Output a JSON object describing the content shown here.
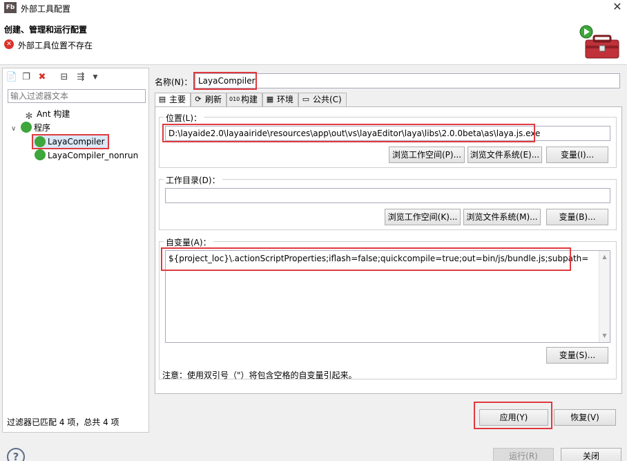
{
  "window": {
    "app_icon_text": "Fb",
    "title": "外部工具配置",
    "close": "✕"
  },
  "header": {
    "title": "创建、管理和运行配置",
    "error_message": "外部工具位置不存在"
  },
  "left": {
    "filter_placeholder": "输入过滤器文本",
    "tree": {
      "ant": "Ant 构建",
      "program": "程序",
      "items": [
        "LayaCompiler",
        "LayaCompiler_nonrun"
      ]
    },
    "footer": "过滤器已匹配 4 项，总共 4 项"
  },
  "main": {
    "name_label": "名称(N)：",
    "name_value": "LayaCompiler",
    "tabs": [
      {
        "label": "主要",
        "icon": "main-tab-icon"
      },
      {
        "label": "刷新",
        "icon": "refresh-tab-icon"
      },
      {
        "label": "构建",
        "icon": "build-tab-icon"
      },
      {
        "label": "环境",
        "icon": "environment-tab-icon"
      },
      {
        "label": "公共(C)",
        "icon": "common-tab-icon"
      }
    ],
    "location": {
      "label": "位置(L)：",
      "value": "D:\\layaide2.0\\layaairide\\resources\\app\\out\\vs\\layaEditor\\laya\\libs\\2.0.0beta\\as\\laya.js.exe",
      "browse_workspace": "浏览工作空间(P)...",
      "browse_filesystem": "浏览文件系统(E)...",
      "variables": "变量(I)..."
    },
    "workdir": {
      "label": "工作目录(D)：",
      "value": "",
      "browse_workspace": "浏览工作空间(K)...",
      "browse_filesystem": "浏览文件系统(M)...",
      "variables": "变量(B)..."
    },
    "arguments": {
      "label": "自变量(A)：",
      "value": "${project_loc}\\.actionScriptProperties;iflash=false;quickcompile=true;out=bin/js/bundle.js;subpath=",
      "variables": "变量(S)...",
      "note": "注意：使用双引号（\"）将包含空格的自变量引起来。"
    },
    "apply": "应用(Y)",
    "revert": "恢复(V)"
  },
  "bottom": {
    "run": "运行(R)",
    "close": "关闭"
  }
}
